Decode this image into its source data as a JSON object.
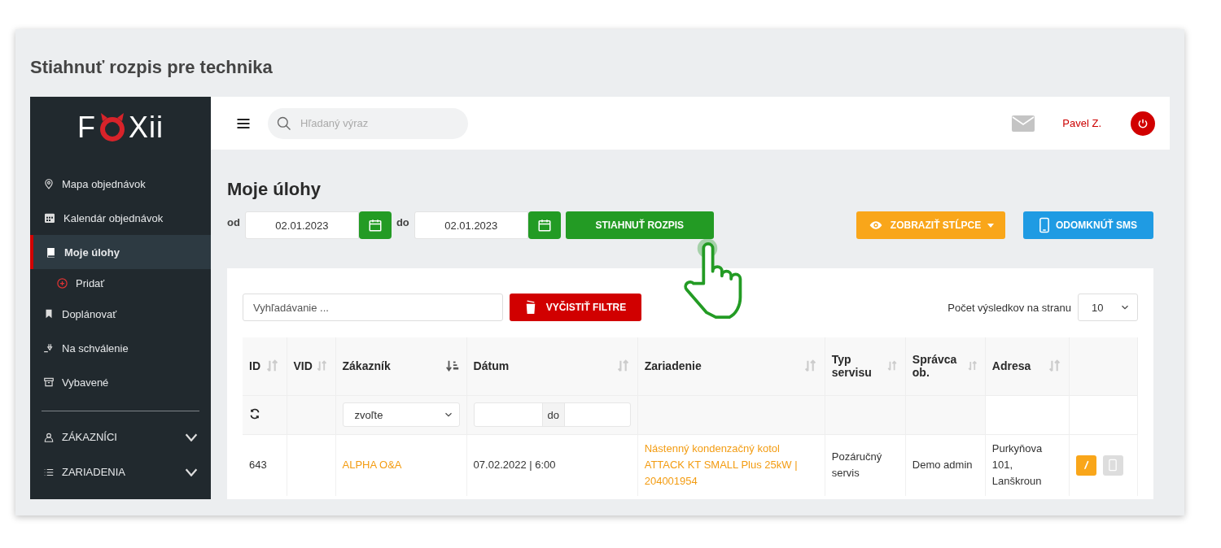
{
  "page_title": "Stiahnuť rozpis pre technika",
  "logo": {
    "before": "F",
    "after": "Xii"
  },
  "sidebar": {
    "items": [
      {
        "kind": "item",
        "label": "Mapa objednávok",
        "selected": false
      },
      {
        "kind": "item",
        "label": "Kalendár objednávok",
        "selected": false
      },
      {
        "kind": "item",
        "label": "Moje úlohy",
        "selected": true
      },
      {
        "kind": "subitem",
        "label": "Pridať",
        "selected": false
      },
      {
        "kind": "item",
        "label": "Doplánovať",
        "selected": false
      },
      {
        "kind": "item",
        "label": "Na schválenie",
        "selected": false
      },
      {
        "kind": "item",
        "label": "Vybavené",
        "selected": false
      },
      {
        "kind": "divider"
      },
      {
        "kind": "section",
        "label": "ZÁKAZNÍCI",
        "expanded": false
      },
      {
        "kind": "section",
        "label": "ZARIADENIA",
        "expanded": false
      }
    ]
  },
  "topbar": {
    "search_placeholder": "Hľadaný výraz",
    "user": "Pavel Z."
  },
  "heading": "Moje úlohy",
  "filters": {
    "from_label": "od",
    "from": "02.01.2023",
    "to_label": "do",
    "to": "02.01.2023"
  },
  "buttons": [
    {
      "kind": "download",
      "label": "STIAHNUŤ ROZPIS"
    },
    {
      "kind": "columns",
      "label": "ZOBRAZIŤ STĹPCE"
    },
    {
      "kind": "sms",
      "label": "ODOMKNÚŤ SMS"
    }
  ],
  "table_tools": {
    "search_placeholder": "Vyhľadávanie ...",
    "clear_label": "VYČISTIŤ FILTRE",
    "per_page_label": "Počet výsledkov na stranu",
    "per_page": "10"
  },
  "table": {
    "columns": [
      {
        "label": "ID",
        "sorted": false
      },
      {
        "label": "VID",
        "sorted": false
      },
      {
        "label": "Zákazník",
        "sorted": true
      },
      {
        "label": "Dátum",
        "sorted": false
      },
      {
        "label": "Zariadenie",
        "sorted": false
      },
      {
        "label": "Typ servisu",
        "sorted": false
      },
      {
        "label": "Správca ob.",
        "sorted": false
      },
      {
        "label": "Adresa",
        "sorted": false
      },
      {
        "kind": "actions"
      }
    ],
    "filter_row": {
      "customer_select": "zvoľte",
      "date_separator": "do"
    },
    "rows": [
      {
        "cells": [
          {
            "kind": "text",
            "text": "643"
          },
          {
            "kind": "empty"
          },
          {
            "kind": "link",
            "text": "ALPHA O&A"
          },
          {
            "kind": "text",
            "text": "07.02.2022 | 6:00"
          },
          {
            "kind": "link",
            "text": "Nástenný kondenzačný kotol ATTACK KT SMALL Plus 25kW | 204001954"
          },
          {
            "kind": "text",
            "text": "Pozáručný servis"
          },
          {
            "kind": "text",
            "text": "Demo admin"
          },
          {
            "kind": "text",
            "text": "Purkyňova 101, Lanškroun"
          },
          {
            "kind": "actions",
            "edit_disabled": false,
            "sms_disabled": true
          }
        ]
      }
    ]
  }
}
